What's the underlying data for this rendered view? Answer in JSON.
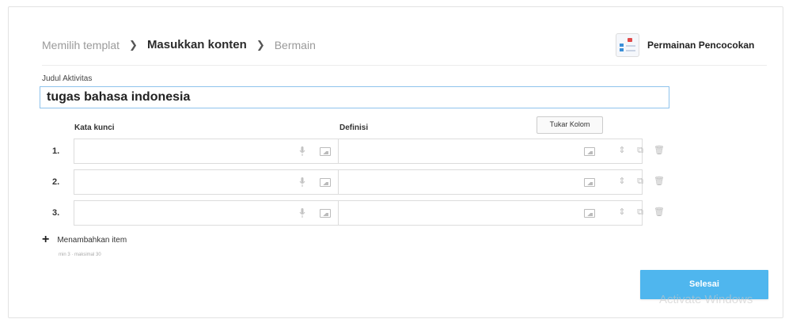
{
  "breadcrumb": {
    "step1": "Memilih templat",
    "step2": "Masukkan konten",
    "step3": "Bermain"
  },
  "game_type": {
    "label": "Permainan Pencocokan"
  },
  "activity_title": {
    "label": "Judul Aktivitas",
    "value": "tugas bahasa indonesia"
  },
  "columns": {
    "keyword": "Kata kunci",
    "definition": "Definisi",
    "swap_button": "Tukar Kolom"
  },
  "items": [
    {
      "number": "1.",
      "keyword": "",
      "definition": ""
    },
    {
      "number": "2.",
      "keyword": "",
      "definition": ""
    },
    {
      "number": "3.",
      "keyword": "",
      "definition": ""
    }
  ],
  "add_item": {
    "label": "Menambahkan item",
    "hint": "min 3 · maksimal 30"
  },
  "done_button": "Selesai",
  "watermark": "Activate Windows",
  "colors": {
    "accent": "#4fb6ee",
    "input_border": "#8fc3ec"
  }
}
